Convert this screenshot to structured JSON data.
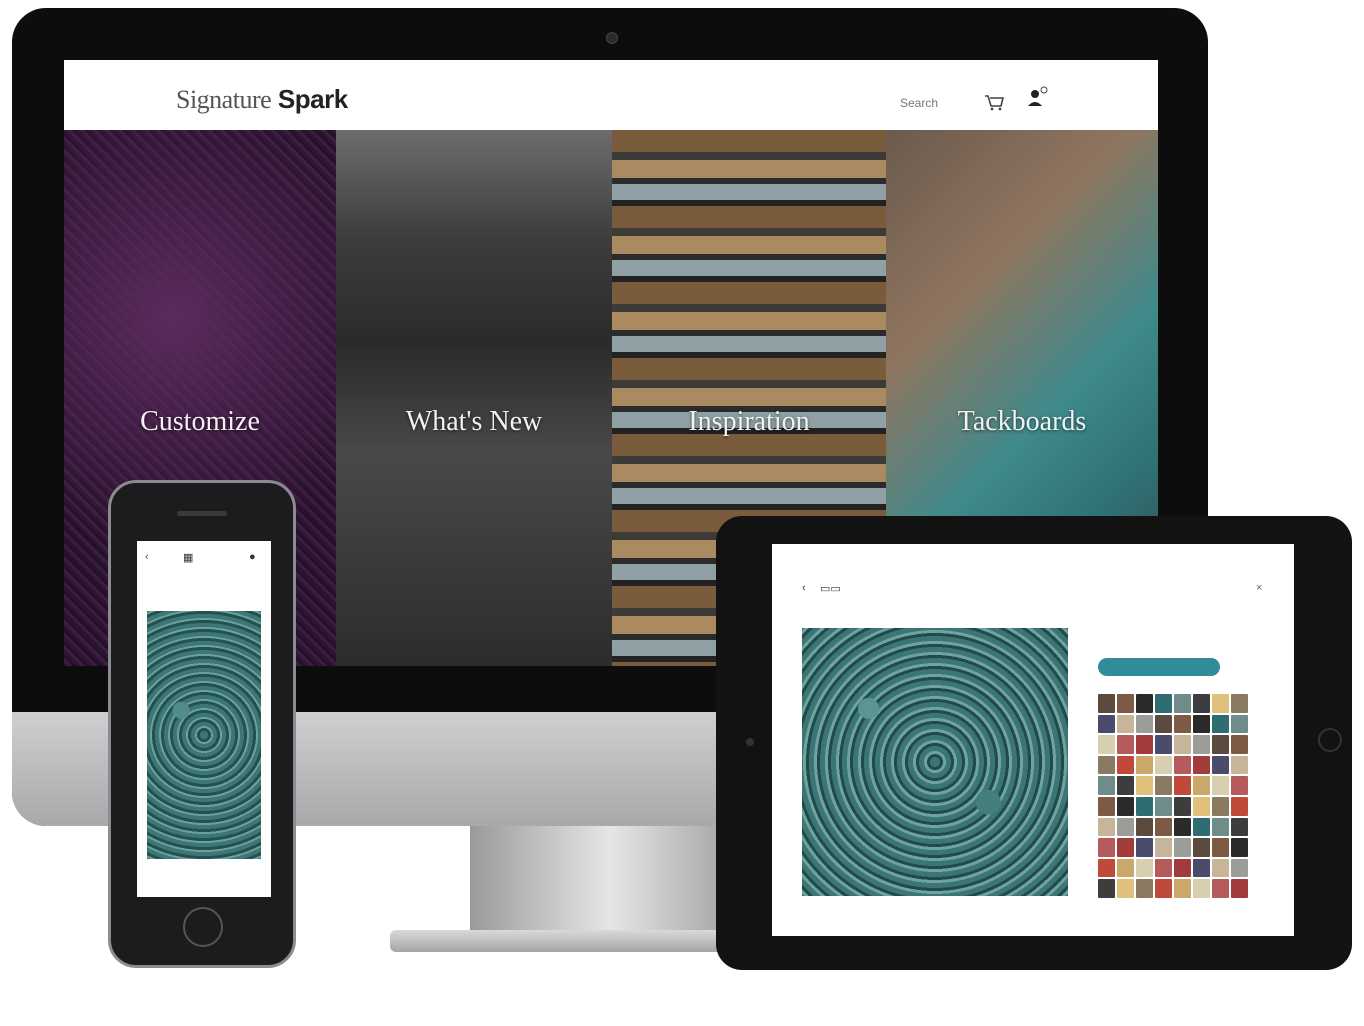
{
  "desktop": {
    "header": {
      "logo_light": "Signature",
      "logo_bold": "Spark",
      "search_label": "Search",
      "icons": [
        "cart-icon",
        "user-icon"
      ]
    },
    "panels": [
      {
        "title": "Customize"
      },
      {
        "title": "What's New"
      },
      {
        "title": "Inspiration"
      },
      {
        "title": "Tackboards"
      }
    ]
  },
  "phone": {
    "back_label": "‹",
    "tabs": [
      "",
      ""
    ]
  },
  "tablet": {
    "back_label": "‹",
    "close_label": "×"
  },
  "colors": {
    "accent": "#2f8c98",
    "device_frame": "#121212",
    "header_bg": "#ffffff"
  }
}
